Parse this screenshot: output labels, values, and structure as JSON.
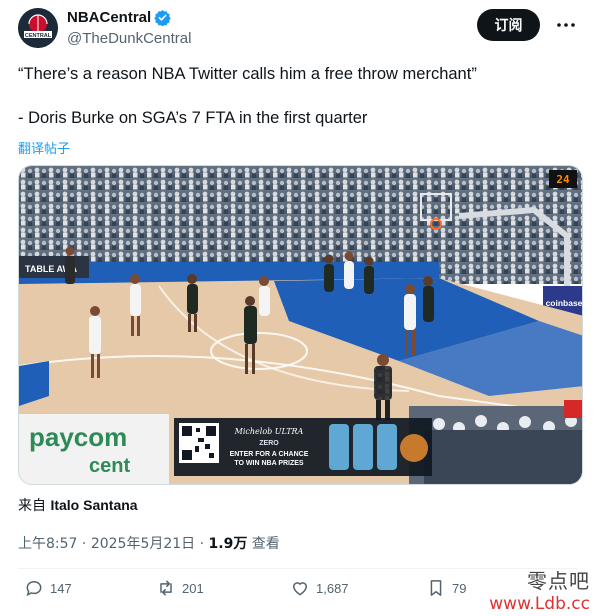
{
  "author": {
    "display_name": "NBACentral",
    "handle": "@TheDunkCentral",
    "avatar_text": "CENTRAL"
  },
  "subscribe_label": "订阅",
  "tweet": {
    "line1": "“There’s a reason NBA Twitter calls him a free throw merchant”",
    "line2": "- Doris Burke on SGA’s 7 FTA in the first quarter"
  },
  "translate_label": "翻译帖子",
  "media": {
    "ad_brand": "Michelob ULTRA",
    "ad_line1": "ZERO",
    "ad_line2": "ENTER FOR A CHANCE",
    "ad_line3": "TO WIN NBA PRIZES",
    "sponsor_left": "paycom",
    "sponsor_left2": "cent",
    "sponsor_right": "coinbase",
    "scoreboard": "24",
    "banner_left": "TABLE AWA"
  },
  "source": {
    "prefix": "来自",
    "name": "Italo Santana"
  },
  "meta": {
    "time": "上午8:57",
    "date": "2025年5月21日",
    "views_count": "1.9万",
    "views_label": "查看"
  },
  "actions": {
    "replies": "147",
    "reposts": "201",
    "likes": "1,687",
    "bookmarks": "79"
  },
  "watermark": {
    "cn": "零点吧",
    "url": "www.Ldb.cc"
  },
  "colors": {
    "verified": "#1d9bf0",
    "link": "#1d9bf0",
    "court_blue": "#1f5fb8",
    "court_wood": "#e6c9a8",
    "text_secondary": "#536471"
  }
}
